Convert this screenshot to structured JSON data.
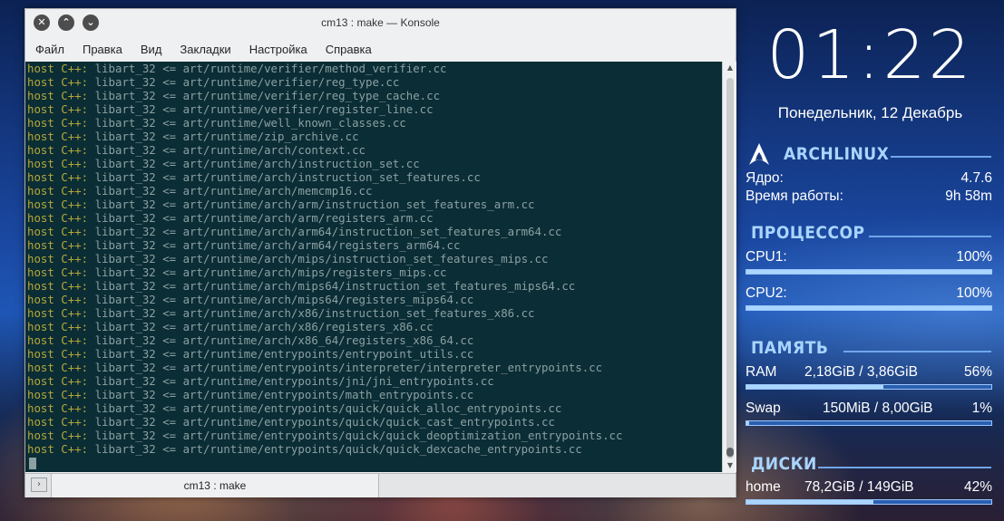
{
  "window": {
    "title": "cm13 : make — Konsole",
    "menu": [
      "Файл",
      "Правка",
      "Вид",
      "Закладки",
      "Настройка",
      "Справка"
    ]
  },
  "terminal": {
    "lines": [
      {
        "host": "host C++:",
        "text": " libart_32 <= art/runtime/verifier/method_verifier.cc"
      },
      {
        "host": "host C++:",
        "text": " libart_32 <= art/runtime/verifier/reg_type.cc"
      },
      {
        "host": "host C++:",
        "text": " libart_32 <= art/runtime/verifier/reg_type_cache.cc"
      },
      {
        "host": "host C++:",
        "text": " libart_32 <= art/runtime/verifier/register_line.cc"
      },
      {
        "host": "host C++:",
        "text": " libart_32 <= art/runtime/well_known_classes.cc"
      },
      {
        "host": "host C++:",
        "text": " libart_32 <= art/runtime/zip_archive.cc"
      },
      {
        "host": "host C++:",
        "text": " libart_32 <= art/runtime/arch/context.cc"
      },
      {
        "host": "host C++:",
        "text": " libart_32 <= art/runtime/arch/instruction_set.cc"
      },
      {
        "host": "host C++:",
        "text": " libart_32 <= art/runtime/arch/instruction_set_features.cc"
      },
      {
        "host": "host C++:",
        "text": " libart_32 <= art/runtime/arch/memcmp16.cc"
      },
      {
        "host": "host C++:",
        "text": " libart_32 <= art/runtime/arch/arm/instruction_set_features_arm.cc"
      },
      {
        "host": "host C++:",
        "text": " libart_32 <= art/runtime/arch/arm/registers_arm.cc"
      },
      {
        "host": "host C++:",
        "text": " libart_32 <= art/runtime/arch/arm64/instruction_set_features_arm64.cc"
      },
      {
        "host": "host C++:",
        "text": " libart_32 <= art/runtime/arch/arm64/registers_arm64.cc"
      },
      {
        "host": "host C++:",
        "text": " libart_32 <= art/runtime/arch/mips/instruction_set_features_mips.cc"
      },
      {
        "host": "host C++:",
        "text": " libart_32 <= art/runtime/arch/mips/registers_mips.cc"
      },
      {
        "host": "host C++:",
        "text": " libart_32 <= art/runtime/arch/mips64/instruction_set_features_mips64.cc"
      },
      {
        "host": "host C++:",
        "text": " libart_32 <= art/runtime/arch/mips64/registers_mips64.cc"
      },
      {
        "host": "host C++:",
        "text": " libart_32 <= art/runtime/arch/x86/instruction_set_features_x86.cc"
      },
      {
        "host": "host C++:",
        "text": " libart_32 <= art/runtime/arch/x86/registers_x86.cc"
      },
      {
        "host": "host C++:",
        "text": " libart_32 <= art/runtime/arch/x86_64/registers_x86_64.cc"
      },
      {
        "host": "host C++:",
        "text": " libart_32 <= art/runtime/entrypoints/entrypoint_utils.cc"
      },
      {
        "host": "host C++:",
        "text": " libart_32 <= art/runtime/entrypoints/interpreter/interpreter_entrypoints.cc"
      },
      {
        "host": "host C++:",
        "text": " libart_32 <= art/runtime/entrypoints/jni/jni_entrypoints.cc"
      },
      {
        "host": "host C++:",
        "text": " libart_32 <= art/runtime/entrypoints/math_entrypoints.cc"
      },
      {
        "host": "host C++:",
        "text": " libart_32 <= art/runtime/entrypoints/quick/quick_alloc_entrypoints.cc"
      },
      {
        "host": "host C++:",
        "text": " libart_32 <= art/runtime/entrypoints/quick/quick_cast_entrypoints.cc"
      },
      {
        "host": "host C++:",
        "text": " libart_32 <= art/runtime/entrypoints/quick/quick_deoptimization_entrypoints.cc"
      },
      {
        "host": "host C++:",
        "text": " libart_32 <= art/runtime/entrypoints/quick/quick_dexcache_entrypoints.cc"
      }
    ]
  },
  "tabs": {
    "active_label": "cm13 : make"
  },
  "conky": {
    "time": "01:22",
    "date": "Понедельник, 12 Декабрь",
    "system": {
      "title": "ARCHLINUX",
      "kernel_label": "Ядро:",
      "kernel_value": "4.7.6",
      "uptime_label": "Время работы:",
      "uptime_value": "9h 58m"
    },
    "cpu": {
      "title": "ПРОЦЕССОР",
      "cpu1_label": "CPU1:",
      "cpu1_value": "100%",
      "cpu1_level": 1.0,
      "cpu2_label": "CPU2:",
      "cpu2_value": "100%",
      "cpu2_level": 1.0
    },
    "memory": {
      "title": "ПАМЯТЬ",
      "ram_label": "RAM",
      "ram_usage": "2,18GiB / 3,86GiB",
      "ram_percent": "56%",
      "ram_level": 0.56,
      "swap_label": "Swap",
      "swap_usage": "150MiB / 8,00GiB",
      "swap_percent": "1%",
      "swap_level": 0.01
    },
    "disks": {
      "title": "ДИСКИ",
      "home_label": "home",
      "home_usage": "78,2GiB / 149GiB",
      "home_percent": "42%",
      "home_level": 0.52
    }
  },
  "colors": {
    "terminal_bg": "#0b2d35",
    "terminal_host": "#b5a83a",
    "terminal_text": "#8ba0a3",
    "conky_heading": "#a9d5ff"
  }
}
